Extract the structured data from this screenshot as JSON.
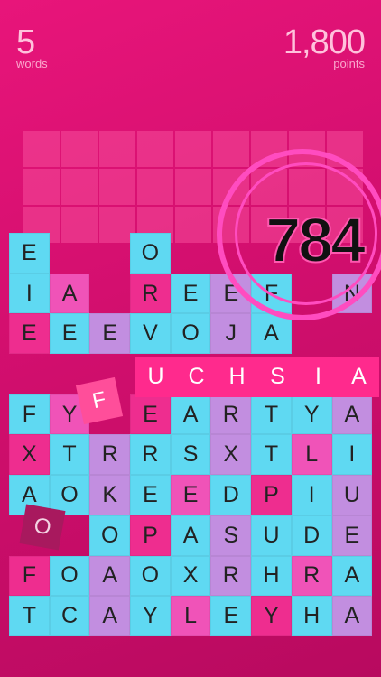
{
  "stats": {
    "words_value": "5",
    "words_label": "words",
    "points_value": "1,800",
    "points_label": "points"
  },
  "score_popup": "784",
  "current_word": [
    "U",
    "C",
    "H",
    "S",
    "I",
    "A"
  ],
  "floating_letters": {
    "f": "F",
    "o": "O"
  },
  "board": [
    [
      "E",
      "",
      "",
      "O",
      "",
      "",
      "",
      "",
      ""
    ],
    [
      "I",
      "A",
      "",
      "R",
      "E",
      "E",
      "F",
      "",
      "N"
    ],
    [
      "E",
      "E",
      "E",
      "V",
      "O",
      "J",
      "A",
      "",
      ""
    ],
    [
      "",
      "",
      "",
      "",
      "",
      "",
      "",
      "",
      ""
    ],
    [
      "F",
      "Y",
      "",
      "E",
      "A",
      "R",
      "T",
      "Y",
      "A"
    ],
    [
      "X",
      "T",
      "R",
      "R",
      "S",
      "X",
      "T",
      "L",
      "I"
    ],
    [
      "A",
      "O",
      "K",
      "E",
      "E",
      "D",
      "P",
      "I",
      "U"
    ],
    [
      "",
      "",
      "O",
      "P",
      "A",
      "S",
      "U",
      "D",
      "E"
    ],
    [
      "F",
      "O",
      "A",
      "O",
      "X",
      "R",
      "H",
      "R",
      "A"
    ],
    [
      "T",
      "C",
      "A",
      "Y",
      "L",
      "E",
      "Y",
      "H",
      "A"
    ]
  ],
  "colors": {
    "accent": "#ff2a8d",
    "tile": "#5fd9f2"
  }
}
